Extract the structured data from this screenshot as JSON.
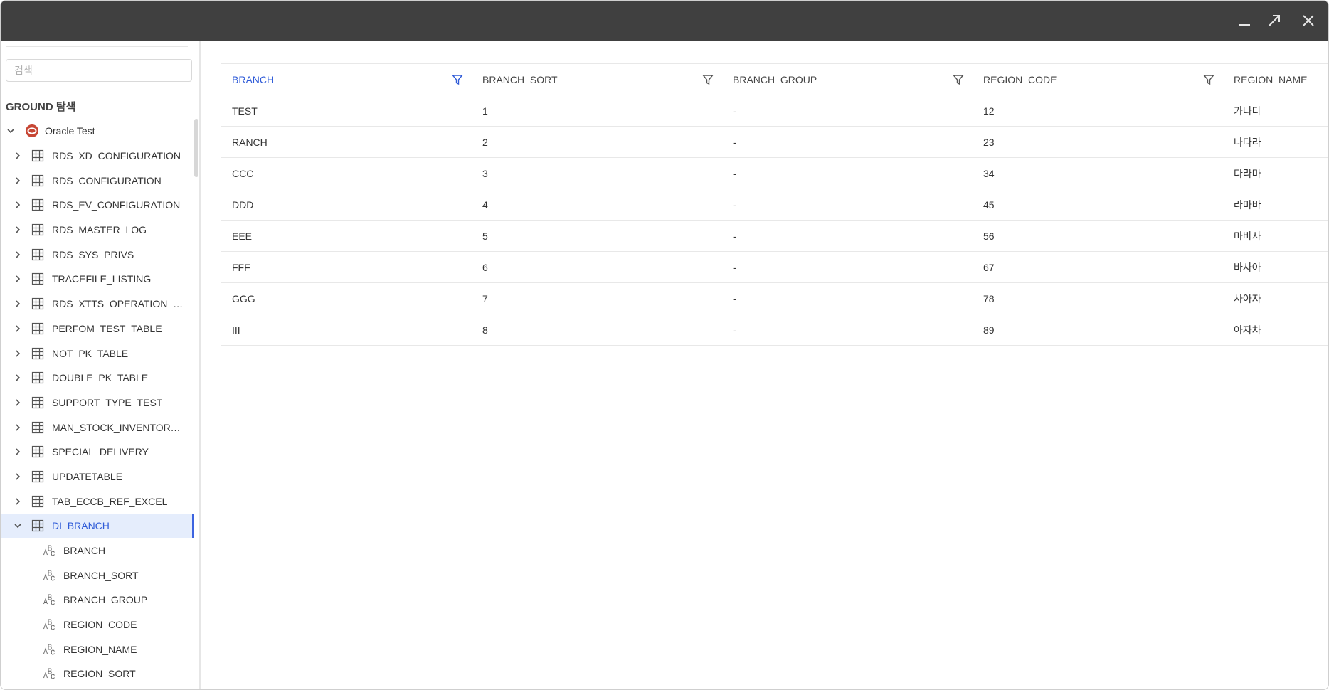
{
  "window": {
    "controls": {
      "minimize": "minimize-icon",
      "maximize": "maximize-icon",
      "close": "close-icon"
    }
  },
  "sidebar": {
    "search_placeholder": "검색",
    "section_title": "GROUND 탐색",
    "root": {
      "label": "Oracle Test",
      "icon": "oracle-db-icon",
      "icon_color": "#c74634"
    },
    "tables": [
      "RDS_XD_CONFIGURATION",
      "RDS_CONFIGURATION",
      "RDS_EV_CONFIGURATION",
      "RDS_MASTER_LOG",
      "RDS_SYS_PRIVS",
      "TRACEFILE_LISTING",
      "RDS_XTTS_OPERATION_IN…",
      "PERFOM_TEST_TABLE",
      "NOT_PK_TABLE",
      "DOUBLE_PK_TABLE",
      "SUPPORT_TYPE_TEST",
      "MAN_STOCK_INVENTORYC…",
      "SPECIAL_DELIVERY",
      "UPDATETABLE",
      "TAB_ECCB_REF_EXCEL"
    ],
    "selected_table": "DI_BRANCH",
    "columns": [
      "BRANCH",
      "BRANCH_SORT",
      "BRANCH_GROUP",
      "REGION_CODE",
      "REGION_NAME",
      "REGION_SORT"
    ]
  },
  "grid": {
    "headers": [
      "BRANCH",
      "BRANCH_SORT",
      "BRANCH_GROUP",
      "REGION_CODE",
      "REGION_NAME"
    ],
    "active_header_index": 0,
    "accent_color": "#2f5bd8",
    "rows": [
      [
        "TEST",
        "1",
        "-",
        "12",
        "가나다"
      ],
      [
        "RANCH",
        "2",
        "-",
        "23",
        "나다라"
      ],
      [
        "CCC",
        "3",
        "-",
        "34",
        "다라마"
      ],
      [
        "DDD",
        "4",
        "-",
        "45",
        "라마바"
      ],
      [
        "EEE",
        "5",
        "-",
        "56",
        "마바사"
      ],
      [
        "FFF",
        "6",
        "-",
        "67",
        "바사아"
      ],
      [
        "GGG",
        "7",
        "-",
        "78",
        "사아자"
      ],
      [
        "III",
        "8",
        "-",
        "89",
        "아자차"
      ]
    ]
  }
}
